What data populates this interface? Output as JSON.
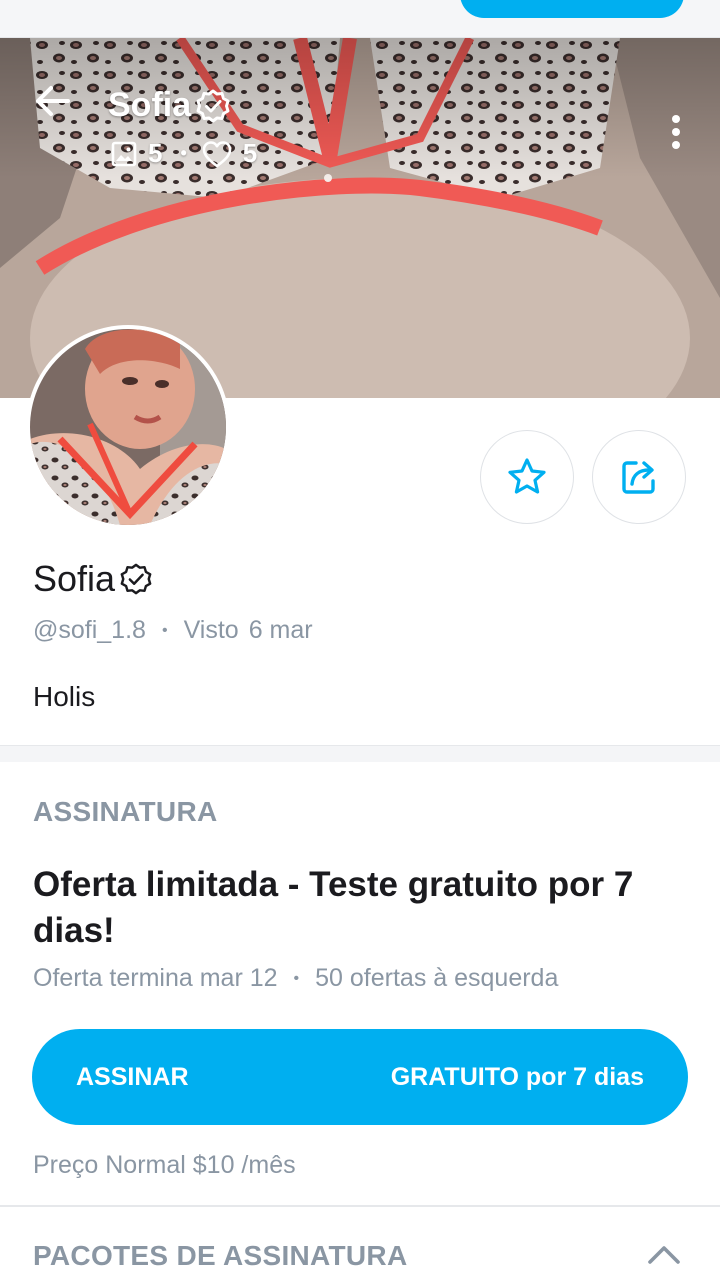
{
  "cover": {
    "name": "Sofia",
    "media_count": "5",
    "likes_count": "5",
    "stat_separator": "•"
  },
  "profile": {
    "name": "Sofia",
    "handle": "@sofi_1.8",
    "separator": "•",
    "seen_label": "Visto",
    "seen_date": "6 mar",
    "bio": "Holis"
  },
  "subscription": {
    "heading": "ASSINATURA",
    "offer_title": "Oferta limitada - Teste gratuito por 7 dias!",
    "offer_ends": "Oferta termina mar 12",
    "separator": "•",
    "offers_left": "50 ofertas à esquerda",
    "button_left": "ASSINAR",
    "button_right": "GRATUITO por 7 dias",
    "regular_price": "Preço Normal $10 /mês"
  },
  "bundles": {
    "heading": "PACOTES DE ASSINATURA"
  },
  "colors": {
    "accent": "#00aff0",
    "muted_text": "#8a96a3",
    "primary_text": "#1b1b1f"
  },
  "icons": {
    "back": "arrow-left-icon",
    "verified": "verified-badge-icon",
    "media": "image-icon",
    "likes": "heart-icon",
    "more": "more-vertical-icon",
    "favorite": "star-icon",
    "share": "share-icon",
    "collapse": "chevron-up-icon"
  }
}
